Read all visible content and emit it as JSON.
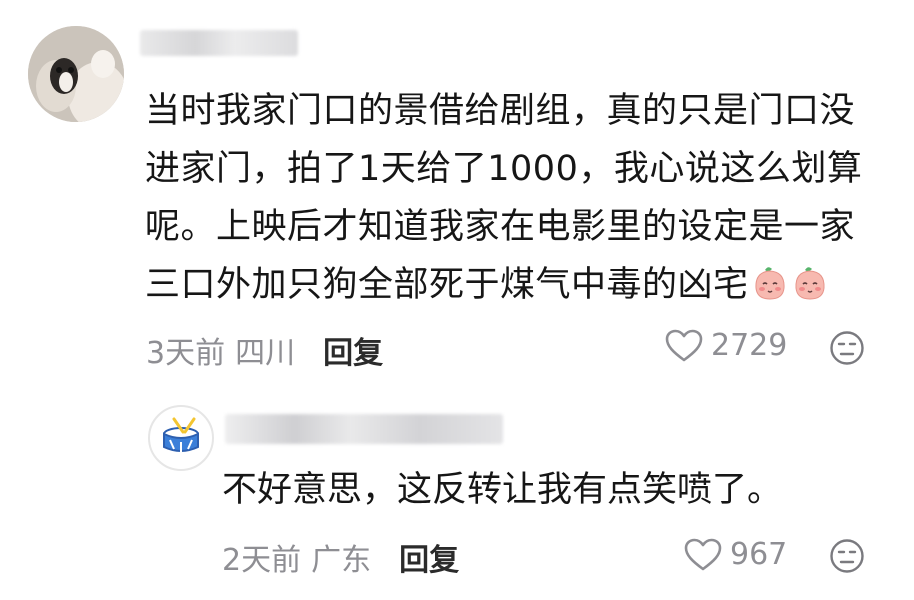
{
  "comment": {
    "text_lines": [
      "当时我家门口的景借给剧组，真的只是门口没",
      "进家门，拍了1天给了1000，我心说这么划算",
      "呢。上映后才知道我家在电影里的设定是一家",
      "三口外加只狗全部死于煤气中毒的凶宅"
    ],
    "emoji": "blushing-peach-emoji",
    "time": "3天前",
    "location": "四川",
    "reply_label": "回复",
    "likes": "2729"
  },
  "reply": {
    "text": "不好意思，这反转让我有点笑喷了。",
    "time": "2天前",
    "location": "广东",
    "reply_label": "回复",
    "likes": "967"
  },
  "colors": {
    "text": "#161616",
    "meta": "#8e8e93",
    "emoji": "#f6b8b0",
    "emoji_leaf": "#56b46b",
    "drum_blue": "#3b7fd9",
    "drum_yellow": "#f3c531"
  }
}
